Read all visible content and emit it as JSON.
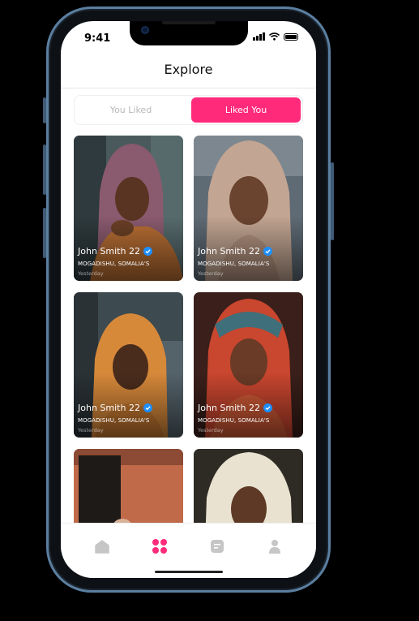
{
  "status_bar": {
    "time": "9:41"
  },
  "header": {
    "title": "Explore"
  },
  "segmented": {
    "tabs": [
      {
        "label": "You Liked",
        "active": false
      },
      {
        "label": "Liked You",
        "active": true
      }
    ],
    "accent_color": "#ff2a7a"
  },
  "cards": [
    {
      "name": "John Smith 22",
      "location": "MOGADISHU, SOMALIA'S",
      "when": "Yesterday",
      "verified": true
    },
    {
      "name": "John Smith 22",
      "location": "MOGADISHU, SOMALIA'S",
      "when": "Yesterday",
      "verified": true
    },
    {
      "name": "John Smith 22",
      "location": "MOGADISHU, SOMALIA'S",
      "when": "Yesterday",
      "verified": true
    },
    {
      "name": "John Smith 22",
      "location": "MOGADISHU, SOMALIA'S",
      "when": "Yesterday",
      "verified": true
    },
    {
      "name": "",
      "location": "",
      "when": "",
      "verified": false
    },
    {
      "name": "",
      "location": "",
      "when": "",
      "verified": false
    }
  ],
  "tabbar": {
    "items": [
      {
        "icon": "home-icon",
        "active": false
      },
      {
        "icon": "grid-icon",
        "active": true
      },
      {
        "icon": "chat-icon",
        "active": false
      },
      {
        "icon": "profile-icon",
        "active": false
      }
    ]
  }
}
